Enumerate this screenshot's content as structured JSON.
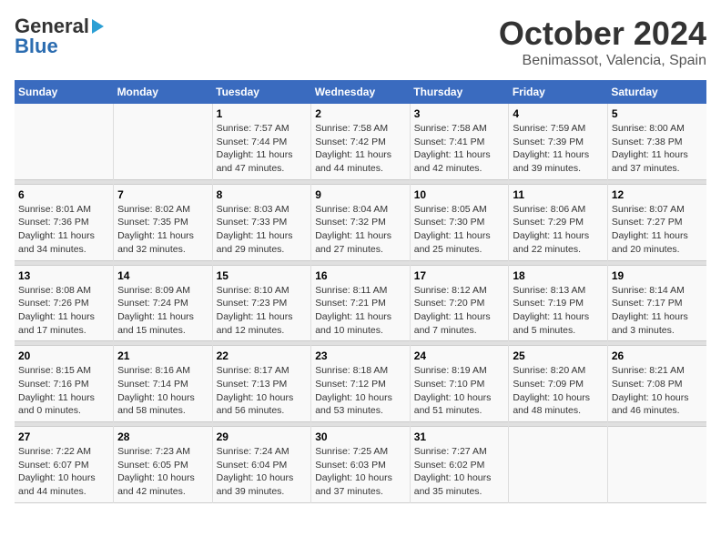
{
  "header": {
    "logo_general": "General",
    "logo_blue": "Blue",
    "month": "October 2024",
    "location": "Benimassot, Valencia, Spain"
  },
  "days_of_week": [
    "Sunday",
    "Monday",
    "Tuesday",
    "Wednesday",
    "Thursday",
    "Friday",
    "Saturday"
  ],
  "weeks": [
    [
      {
        "day": "",
        "info": ""
      },
      {
        "day": "",
        "info": ""
      },
      {
        "day": "1",
        "info": "Sunrise: 7:57 AM\nSunset: 7:44 PM\nDaylight: 11 hours and 47 minutes."
      },
      {
        "day": "2",
        "info": "Sunrise: 7:58 AM\nSunset: 7:42 PM\nDaylight: 11 hours and 44 minutes."
      },
      {
        "day": "3",
        "info": "Sunrise: 7:58 AM\nSunset: 7:41 PM\nDaylight: 11 hours and 42 minutes."
      },
      {
        "day": "4",
        "info": "Sunrise: 7:59 AM\nSunset: 7:39 PM\nDaylight: 11 hours and 39 minutes."
      },
      {
        "day": "5",
        "info": "Sunrise: 8:00 AM\nSunset: 7:38 PM\nDaylight: 11 hours and 37 minutes."
      }
    ],
    [
      {
        "day": "6",
        "info": "Sunrise: 8:01 AM\nSunset: 7:36 PM\nDaylight: 11 hours and 34 minutes."
      },
      {
        "day": "7",
        "info": "Sunrise: 8:02 AM\nSunset: 7:35 PM\nDaylight: 11 hours and 32 minutes."
      },
      {
        "day": "8",
        "info": "Sunrise: 8:03 AM\nSunset: 7:33 PM\nDaylight: 11 hours and 29 minutes."
      },
      {
        "day": "9",
        "info": "Sunrise: 8:04 AM\nSunset: 7:32 PM\nDaylight: 11 hours and 27 minutes."
      },
      {
        "day": "10",
        "info": "Sunrise: 8:05 AM\nSunset: 7:30 PM\nDaylight: 11 hours and 25 minutes."
      },
      {
        "day": "11",
        "info": "Sunrise: 8:06 AM\nSunset: 7:29 PM\nDaylight: 11 hours and 22 minutes."
      },
      {
        "day": "12",
        "info": "Sunrise: 8:07 AM\nSunset: 7:27 PM\nDaylight: 11 hours and 20 minutes."
      }
    ],
    [
      {
        "day": "13",
        "info": "Sunrise: 8:08 AM\nSunset: 7:26 PM\nDaylight: 11 hours and 17 minutes."
      },
      {
        "day": "14",
        "info": "Sunrise: 8:09 AM\nSunset: 7:24 PM\nDaylight: 11 hours and 15 minutes."
      },
      {
        "day": "15",
        "info": "Sunrise: 8:10 AM\nSunset: 7:23 PM\nDaylight: 11 hours and 12 minutes."
      },
      {
        "day": "16",
        "info": "Sunrise: 8:11 AM\nSunset: 7:21 PM\nDaylight: 11 hours and 10 minutes."
      },
      {
        "day": "17",
        "info": "Sunrise: 8:12 AM\nSunset: 7:20 PM\nDaylight: 11 hours and 7 minutes."
      },
      {
        "day": "18",
        "info": "Sunrise: 8:13 AM\nSunset: 7:19 PM\nDaylight: 11 hours and 5 minutes."
      },
      {
        "day": "19",
        "info": "Sunrise: 8:14 AM\nSunset: 7:17 PM\nDaylight: 11 hours and 3 minutes."
      }
    ],
    [
      {
        "day": "20",
        "info": "Sunrise: 8:15 AM\nSunset: 7:16 PM\nDaylight: 11 hours and 0 minutes."
      },
      {
        "day": "21",
        "info": "Sunrise: 8:16 AM\nSunset: 7:14 PM\nDaylight: 10 hours and 58 minutes."
      },
      {
        "day": "22",
        "info": "Sunrise: 8:17 AM\nSunset: 7:13 PM\nDaylight: 10 hours and 56 minutes."
      },
      {
        "day": "23",
        "info": "Sunrise: 8:18 AM\nSunset: 7:12 PM\nDaylight: 10 hours and 53 minutes."
      },
      {
        "day": "24",
        "info": "Sunrise: 8:19 AM\nSunset: 7:10 PM\nDaylight: 10 hours and 51 minutes."
      },
      {
        "day": "25",
        "info": "Sunrise: 8:20 AM\nSunset: 7:09 PM\nDaylight: 10 hours and 48 minutes."
      },
      {
        "day": "26",
        "info": "Sunrise: 8:21 AM\nSunset: 7:08 PM\nDaylight: 10 hours and 46 minutes."
      }
    ],
    [
      {
        "day": "27",
        "info": "Sunrise: 7:22 AM\nSunset: 6:07 PM\nDaylight: 10 hours and 44 minutes."
      },
      {
        "day": "28",
        "info": "Sunrise: 7:23 AM\nSunset: 6:05 PM\nDaylight: 10 hours and 42 minutes."
      },
      {
        "day": "29",
        "info": "Sunrise: 7:24 AM\nSunset: 6:04 PM\nDaylight: 10 hours and 39 minutes."
      },
      {
        "day": "30",
        "info": "Sunrise: 7:25 AM\nSunset: 6:03 PM\nDaylight: 10 hours and 37 minutes."
      },
      {
        "day": "31",
        "info": "Sunrise: 7:27 AM\nSunset: 6:02 PM\nDaylight: 10 hours and 35 minutes."
      },
      {
        "day": "",
        "info": ""
      },
      {
        "day": "",
        "info": ""
      }
    ]
  ]
}
